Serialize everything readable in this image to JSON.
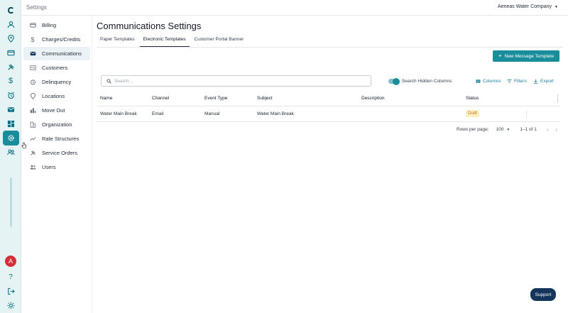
{
  "header": {
    "breadcrumb": "Settings",
    "company": "Aeneas Water Company"
  },
  "rail": {
    "items": [
      "logo-icon",
      "person-icon",
      "location-icon",
      "card-icon",
      "tools-icon",
      "dollar-icon",
      "alarm-icon",
      "mail-icon",
      "dashboard-icon",
      "settings-icon",
      "people-icon"
    ],
    "active": "settings-icon",
    "avatar_letter": "A",
    "bottom": [
      "help-icon",
      "logout-icon",
      "sun-icon"
    ]
  },
  "menu": {
    "items": [
      {
        "label": "Billing",
        "icon": "card-icon"
      },
      {
        "label": "Charges/Credits",
        "icon": "dollar-icon"
      },
      {
        "label": "Communications",
        "icon": "mail-icon",
        "active": true
      },
      {
        "label": "Customers",
        "icon": "customer-card-icon"
      },
      {
        "label": "Delinquency",
        "icon": "alarm-icon"
      },
      {
        "label": "Locations",
        "icon": "location-icon"
      },
      {
        "label": "Move Out",
        "icon": "move-out-icon"
      },
      {
        "label": "Organization",
        "icon": "building-icon"
      },
      {
        "label": "Rate Structures",
        "icon": "trend-icon"
      },
      {
        "label": "Service Orders",
        "icon": "tools-icon"
      },
      {
        "label": "Users",
        "icon": "people-icon"
      }
    ]
  },
  "main": {
    "title": "Communications Settings",
    "tabs": [
      {
        "label": "Paper Templates"
      },
      {
        "label": "Electronic Templates",
        "active": true
      },
      {
        "label": "Customer Portal Banner"
      }
    ],
    "new_button": "New Message Template",
    "search_placeholder": "Search…",
    "toggle_label": "Search Hidden Columns",
    "toggle_on": true,
    "tools": {
      "columns": "Columns",
      "filters": "Filters",
      "export": "Export"
    }
  },
  "table": {
    "columns": [
      "Name",
      "Channel",
      "Event Type",
      "Subject",
      "Description",
      "Status"
    ],
    "rows": [
      {
        "name": "Water Main Break",
        "channel": "Email",
        "event_type": "Manual",
        "subject": "Water Main Break",
        "description": "",
        "status": "Draft"
      }
    ]
  },
  "pagination": {
    "rows_per_page_label": "Rows per page:",
    "rows_per_page": "100",
    "range": "1–1 of 1"
  },
  "support_label": "Support",
  "colors": {
    "accent": "#1a8d9b",
    "navy": "#14365c",
    "draft_bg": "#fff0c2",
    "draft_text": "#b7791f"
  }
}
